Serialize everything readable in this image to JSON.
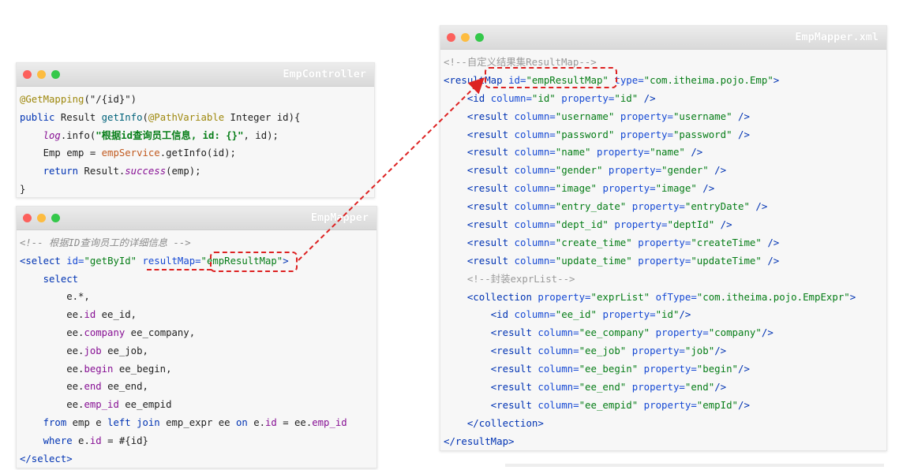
{
  "colors": {
    "accent_red": "#dd2222",
    "title_gradient_top": "#ececec",
    "title_gradient_bottom": "#d9d9d9"
  },
  "controller": {
    "title": "EmpController",
    "lines": [
      [
        {
          "t": "@GetMapping",
          "c": "c-ann"
        },
        {
          "t": "(\"/{id}\")",
          "c": "c-plain"
        }
      ],
      [
        {
          "t": "public ",
          "c": "c-kw"
        },
        {
          "t": "Result ",
          "c": "c-plain"
        },
        {
          "t": "getInfo",
          "c": "c-fn"
        },
        {
          "t": "(",
          "c": "c-plain"
        },
        {
          "t": "@PathVariable ",
          "c": "c-ann"
        },
        {
          "t": "Integer id){",
          "c": "c-plain"
        }
      ],
      [
        {
          "t": "    ",
          "c": "c-plain"
        },
        {
          "t": "log",
          "c": "c-it"
        },
        {
          "t": ".info(",
          "c": "c-plain"
        },
        {
          "t": "\"根据id查询员工信息, id: {}\"",
          "c": "c-str"
        },
        {
          "t": ", id);",
          "c": "c-plain"
        }
      ],
      [
        {
          "t": "    Emp emp = ",
          "c": "c-plain"
        },
        {
          "t": "empService",
          "c": "c-field"
        },
        {
          "t": ".getInfo(id);",
          "c": "c-plain"
        }
      ],
      [
        {
          "t": "    ",
          "c": "c-plain"
        },
        {
          "t": "return ",
          "c": "c-kw"
        },
        {
          "t": "Result.",
          "c": "c-plain"
        },
        {
          "t": "success",
          "c": "c-it"
        },
        {
          "t": "(emp);",
          "c": "c-plain"
        }
      ],
      [
        {
          "t": "}",
          "c": "c-plain"
        }
      ]
    ]
  },
  "mapper": {
    "title": "EmpMapper",
    "lines": [
      [
        {
          "t": "<!-- 根据ID查询员工的详细信息 -->",
          "c": "c-cmt"
        }
      ],
      [
        {
          "t": "<select ",
          "c": "c-tag"
        },
        {
          "t": "id=",
          "c": "c-attr"
        },
        {
          "t": "\"getById\" ",
          "c": "c-val"
        },
        {
          "t": "resultMap=",
          "c": "c-attr"
        },
        {
          "t": "\"empResultMap\"",
          "c": "c-val"
        },
        {
          "t": ">",
          "c": "c-tag"
        }
      ],
      [
        {
          "t": "    ",
          "c": "c-plain"
        },
        {
          "t": "select",
          "c": "c-kw"
        }
      ],
      [
        {
          "t": "        e.*,",
          "c": "c-plain"
        }
      ],
      [
        {
          "t": "        ee.",
          "c": "c-plain"
        },
        {
          "t": "id ",
          "c": "c-sfx"
        },
        {
          "t": "ee_id,",
          "c": "c-plain"
        }
      ],
      [
        {
          "t": "        ee.",
          "c": "c-plain"
        },
        {
          "t": "company ",
          "c": "c-sfx"
        },
        {
          "t": "ee_company,",
          "c": "c-plain"
        }
      ],
      [
        {
          "t": "        ee.",
          "c": "c-plain"
        },
        {
          "t": "job ",
          "c": "c-sfx"
        },
        {
          "t": "ee_job,",
          "c": "c-plain"
        }
      ],
      [
        {
          "t": "        ee.",
          "c": "c-plain"
        },
        {
          "t": "begin ",
          "c": "c-sfx"
        },
        {
          "t": "ee_begin,",
          "c": "c-plain"
        }
      ],
      [
        {
          "t": "        ee.",
          "c": "c-plain"
        },
        {
          "t": "end ",
          "c": "c-sfx"
        },
        {
          "t": "ee_end,",
          "c": "c-plain"
        }
      ],
      [
        {
          "t": "        ee.",
          "c": "c-plain"
        },
        {
          "t": "emp_id ",
          "c": "c-sfx"
        },
        {
          "t": "ee_empid",
          "c": "c-plain"
        }
      ],
      [
        {
          "t": "    ",
          "c": "c-plain"
        },
        {
          "t": "from ",
          "c": "c-kw"
        },
        {
          "t": "emp e ",
          "c": "c-plain"
        },
        {
          "t": "left join ",
          "c": "c-kw"
        },
        {
          "t": "emp_expr ee ",
          "c": "c-plain"
        },
        {
          "t": "on ",
          "c": "c-kw"
        },
        {
          "t": "e.",
          "c": "c-plain"
        },
        {
          "t": "id",
          "c": "c-sfx"
        },
        {
          "t": " = ee.",
          "c": "c-plain"
        },
        {
          "t": "emp_id",
          "c": "c-sfx"
        }
      ],
      [
        {
          "t": "    ",
          "c": "c-plain"
        },
        {
          "t": "where ",
          "c": "c-kw"
        },
        {
          "t": "e.",
          "c": "c-plain"
        },
        {
          "t": "id",
          "c": "c-sfx"
        },
        {
          "t": " = #{id}",
          "c": "c-plain"
        }
      ],
      [
        {
          "t": "</select>",
          "c": "c-tag"
        }
      ]
    ]
  },
  "xml": {
    "title": "EmpMapper.xml",
    "lines": [
      [
        {
          "t": "<!--自定义结果集ResultMap-->",
          "c": "c-cmtx"
        }
      ],
      [
        {
          "t": "<resultMap ",
          "c": "c-tag"
        },
        {
          "t": "id=",
          "c": "c-attr"
        },
        {
          "t": "\"empResultMap\" ",
          "c": "c-val"
        },
        {
          "t": "type=",
          "c": "c-attr"
        },
        {
          "t": "\"com.itheima.pojo.Emp\"",
          "c": "c-val"
        },
        {
          "t": ">",
          "c": "c-tag"
        }
      ],
      [
        {
          "t": "    ",
          "c": "c-plain"
        },
        {
          "t": "<id ",
          "c": "c-tag"
        },
        {
          "t": "column=",
          "c": "c-attr"
        },
        {
          "t": "\"id\" ",
          "c": "c-val"
        },
        {
          "t": "property=",
          "c": "c-attr"
        },
        {
          "t": "\"id\" ",
          "c": "c-val"
        },
        {
          "t": "/>",
          "c": "c-tag"
        }
      ],
      [
        {
          "t": "    ",
          "c": "c-plain"
        },
        {
          "t": "<result ",
          "c": "c-tag"
        },
        {
          "t": "column=",
          "c": "c-attr"
        },
        {
          "t": "\"username\" ",
          "c": "c-val"
        },
        {
          "t": "property=",
          "c": "c-attr"
        },
        {
          "t": "\"username\" ",
          "c": "c-val"
        },
        {
          "t": "/>",
          "c": "c-tag"
        }
      ],
      [
        {
          "t": "    ",
          "c": "c-plain"
        },
        {
          "t": "<result ",
          "c": "c-tag"
        },
        {
          "t": "column=",
          "c": "c-attr"
        },
        {
          "t": "\"password\" ",
          "c": "c-val"
        },
        {
          "t": "property=",
          "c": "c-attr"
        },
        {
          "t": "\"password\" ",
          "c": "c-val"
        },
        {
          "t": "/>",
          "c": "c-tag"
        }
      ],
      [
        {
          "t": "    ",
          "c": "c-plain"
        },
        {
          "t": "<result ",
          "c": "c-tag"
        },
        {
          "t": "column=",
          "c": "c-attr"
        },
        {
          "t": "\"name\" ",
          "c": "c-val"
        },
        {
          "t": "property=",
          "c": "c-attr"
        },
        {
          "t": "\"name\" ",
          "c": "c-val"
        },
        {
          "t": "/>",
          "c": "c-tag"
        }
      ],
      [
        {
          "t": "    ",
          "c": "c-plain"
        },
        {
          "t": "<result ",
          "c": "c-tag"
        },
        {
          "t": "column=",
          "c": "c-attr"
        },
        {
          "t": "\"gender\" ",
          "c": "c-val"
        },
        {
          "t": "property=",
          "c": "c-attr"
        },
        {
          "t": "\"gender\" ",
          "c": "c-val"
        },
        {
          "t": "/>",
          "c": "c-tag"
        }
      ],
      [
        {
          "t": "    ",
          "c": "c-plain"
        },
        {
          "t": "<result ",
          "c": "c-tag"
        },
        {
          "t": "column=",
          "c": "c-attr"
        },
        {
          "t": "\"image\" ",
          "c": "c-val"
        },
        {
          "t": "property=",
          "c": "c-attr"
        },
        {
          "t": "\"image\" ",
          "c": "c-val"
        },
        {
          "t": "/>",
          "c": "c-tag"
        }
      ],
      [
        {
          "t": "    ",
          "c": "c-plain"
        },
        {
          "t": "<result ",
          "c": "c-tag"
        },
        {
          "t": "column=",
          "c": "c-attr"
        },
        {
          "t": "\"entry_date\" ",
          "c": "c-val"
        },
        {
          "t": "property=",
          "c": "c-attr"
        },
        {
          "t": "\"entryDate\" ",
          "c": "c-val"
        },
        {
          "t": "/>",
          "c": "c-tag"
        }
      ],
      [
        {
          "t": "    ",
          "c": "c-plain"
        },
        {
          "t": "<result ",
          "c": "c-tag"
        },
        {
          "t": "column=",
          "c": "c-attr"
        },
        {
          "t": "\"dept_id\" ",
          "c": "c-val"
        },
        {
          "t": "property=",
          "c": "c-attr"
        },
        {
          "t": "\"deptId\" ",
          "c": "c-val"
        },
        {
          "t": "/>",
          "c": "c-tag"
        }
      ],
      [
        {
          "t": "    ",
          "c": "c-plain"
        },
        {
          "t": "<result ",
          "c": "c-tag"
        },
        {
          "t": "column=",
          "c": "c-attr"
        },
        {
          "t": "\"create_time\" ",
          "c": "c-val"
        },
        {
          "t": "property=",
          "c": "c-attr"
        },
        {
          "t": "\"createTime\" ",
          "c": "c-val"
        },
        {
          "t": "/>",
          "c": "c-tag"
        }
      ],
      [
        {
          "t": "    ",
          "c": "c-plain"
        },
        {
          "t": "<result ",
          "c": "c-tag"
        },
        {
          "t": "column=",
          "c": "c-attr"
        },
        {
          "t": "\"update_time\" ",
          "c": "c-val"
        },
        {
          "t": "property=",
          "c": "c-attr"
        },
        {
          "t": "\"updateTime\" ",
          "c": "c-val"
        },
        {
          "t": "/>",
          "c": "c-tag"
        }
      ],
      [
        {
          "t": "    ",
          "c": "c-plain"
        },
        {
          "t": "<!--封装exprList-->",
          "c": "c-cmtx"
        }
      ],
      [
        {
          "t": "    ",
          "c": "c-plain"
        },
        {
          "t": "<collection ",
          "c": "c-tag"
        },
        {
          "t": "property=",
          "c": "c-attr"
        },
        {
          "t": "\"exprList\" ",
          "c": "c-val"
        },
        {
          "t": "ofType=",
          "c": "c-attr"
        },
        {
          "t": "\"com.itheima.pojo.EmpExpr\"",
          "c": "c-val"
        },
        {
          "t": ">",
          "c": "c-tag"
        }
      ],
      [
        {
          "t": "        ",
          "c": "c-plain"
        },
        {
          "t": "<id ",
          "c": "c-tag"
        },
        {
          "t": "column=",
          "c": "c-attr"
        },
        {
          "t": "\"ee_id\" ",
          "c": "c-val"
        },
        {
          "t": "property=",
          "c": "c-attr"
        },
        {
          "t": "\"id\"",
          "c": "c-val"
        },
        {
          "t": "/>",
          "c": "c-tag"
        }
      ],
      [
        {
          "t": "        ",
          "c": "c-plain"
        },
        {
          "t": "<result ",
          "c": "c-tag"
        },
        {
          "t": "column=",
          "c": "c-attr"
        },
        {
          "t": "\"ee_company\" ",
          "c": "c-val"
        },
        {
          "t": "property=",
          "c": "c-attr"
        },
        {
          "t": "\"company\"",
          "c": "c-val"
        },
        {
          "t": "/>",
          "c": "c-tag"
        }
      ],
      [
        {
          "t": "        ",
          "c": "c-plain"
        },
        {
          "t": "<result ",
          "c": "c-tag"
        },
        {
          "t": "column=",
          "c": "c-attr"
        },
        {
          "t": "\"ee_job\" ",
          "c": "c-val"
        },
        {
          "t": "property=",
          "c": "c-attr"
        },
        {
          "t": "\"job\"",
          "c": "c-val"
        },
        {
          "t": "/>",
          "c": "c-tag"
        }
      ],
      [
        {
          "t": "        ",
          "c": "c-plain"
        },
        {
          "t": "<result ",
          "c": "c-tag"
        },
        {
          "t": "column=",
          "c": "c-attr"
        },
        {
          "t": "\"ee_begin\" ",
          "c": "c-val"
        },
        {
          "t": "property=",
          "c": "c-attr"
        },
        {
          "t": "\"begin\"",
          "c": "c-val"
        },
        {
          "t": "/>",
          "c": "c-tag"
        }
      ],
      [
        {
          "t": "        ",
          "c": "c-plain"
        },
        {
          "t": "<result ",
          "c": "c-tag"
        },
        {
          "t": "column=",
          "c": "c-attr"
        },
        {
          "t": "\"ee_end\" ",
          "c": "c-val"
        },
        {
          "t": "property=",
          "c": "c-attr"
        },
        {
          "t": "\"end\"",
          "c": "c-val"
        },
        {
          "t": "/>",
          "c": "c-tag"
        }
      ],
      [
        {
          "t": "        ",
          "c": "c-plain"
        },
        {
          "t": "<result ",
          "c": "c-tag"
        },
        {
          "t": "column=",
          "c": "c-attr"
        },
        {
          "t": "\"ee_empid\" ",
          "c": "c-val"
        },
        {
          "t": "property=",
          "c": "c-attr"
        },
        {
          "t": "\"empId\"",
          "c": "c-val"
        },
        {
          "t": "/>",
          "c": "c-tag"
        }
      ],
      [
        {
          "t": "    ",
          "c": "c-plain"
        },
        {
          "t": "</collection>",
          "c": "c-tag"
        }
      ],
      [
        {
          "t": "</resultMap>",
          "c": "c-tag"
        }
      ]
    ]
  }
}
